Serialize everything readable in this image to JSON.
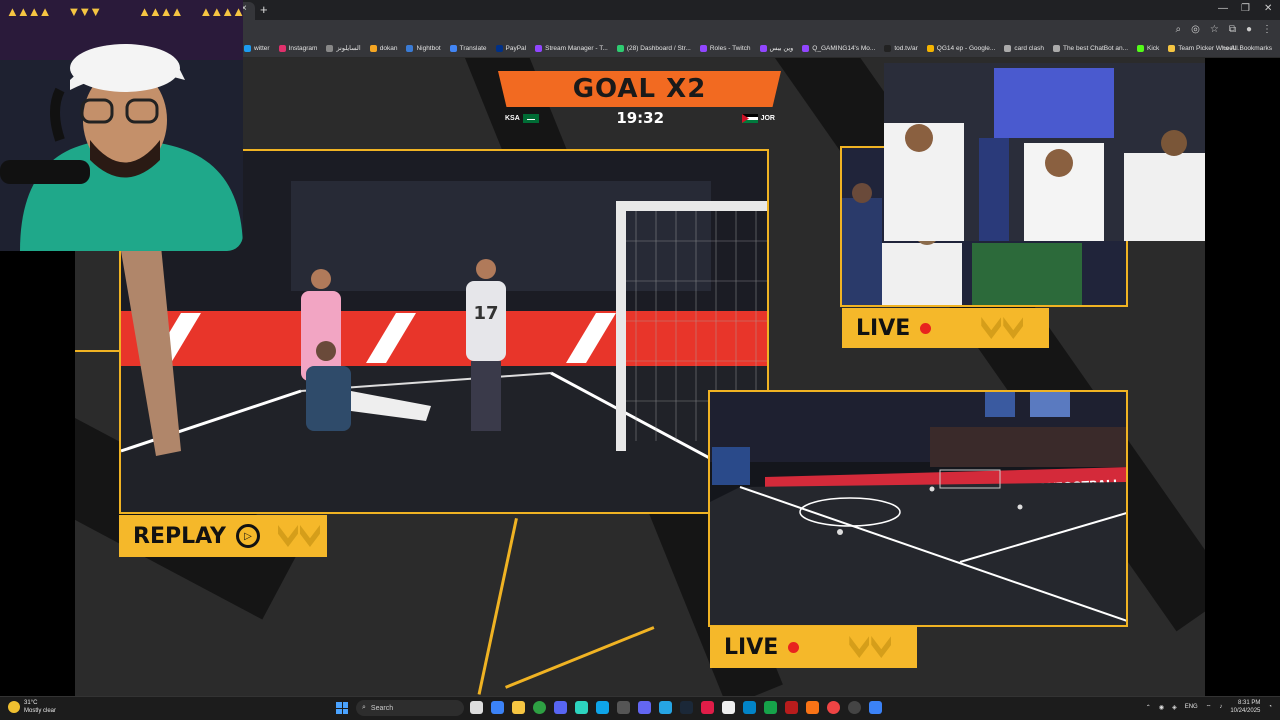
{
  "browser": {
    "tab_close": "×",
    "new_tab": "+",
    "window_controls": [
      "—",
      "❐",
      "✕"
    ],
    "bookmarks": [
      {
        "label": "witter",
        "color": "#1d9bf0"
      },
      {
        "label": "Instagram",
        "color": "#e1306c"
      },
      {
        "label": "السايلونز",
        "color": "#888888"
      },
      {
        "label": "dokan",
        "color": "#f5a623"
      },
      {
        "label": "Nightbot",
        "color": "#3a7bd5"
      },
      {
        "label": "Translate",
        "color": "#4285f4"
      },
      {
        "label": "PayPal",
        "color": "#003087"
      },
      {
        "label": "Stream Manager - T...",
        "color": "#9146ff"
      },
      {
        "label": "(28) Dashboard / Str...",
        "color": "#2ecc71"
      },
      {
        "label": "Roles - Twitch",
        "color": "#9146ff"
      },
      {
        "label": "وين بيس",
        "color": "#9146ff"
      },
      {
        "label": "Q_GAMING14's Mo...",
        "color": "#9146ff"
      },
      {
        "label": "tod.tv/ar",
        "color": "#222222"
      },
      {
        "label": "QG14 ep - Google...",
        "color": "#f4b400"
      },
      {
        "label": "card clash",
        "color": "#aaaaaa"
      },
      {
        "label": "The best ChatBot an...",
        "color": "#aaaaaa"
      },
      {
        "label": "Kick",
        "color": "#53fc18"
      },
      {
        "label": "Team Picker Wheel...",
        "color": "#f5c542"
      }
    ],
    "all_bookmarks": "All Bookmarks"
  },
  "broadcast": {
    "goal_banner": "GOAL X2",
    "team_left": "KSA",
    "team_right": "JOR",
    "clock": "19:32",
    "replay_label": "REPLAY",
    "live_label_top": "LIVE",
    "live_label_bottom": "LIVE",
    "replay_icon_glyph": "▷",
    "ad_banner": "ADIDAS.COM/FOOTBALL",
    "player_number": "17",
    "colors": {
      "accent": "#f0b323",
      "banner": "#f26a21",
      "live_dot": "#e8231e"
    }
  },
  "taskbar": {
    "weather_temp": "31°C",
    "weather_desc": "Mostly clear",
    "search_placeholder": "Search",
    "lang": "ENG",
    "time": "8:31 PM",
    "date": "10/24/2025"
  }
}
